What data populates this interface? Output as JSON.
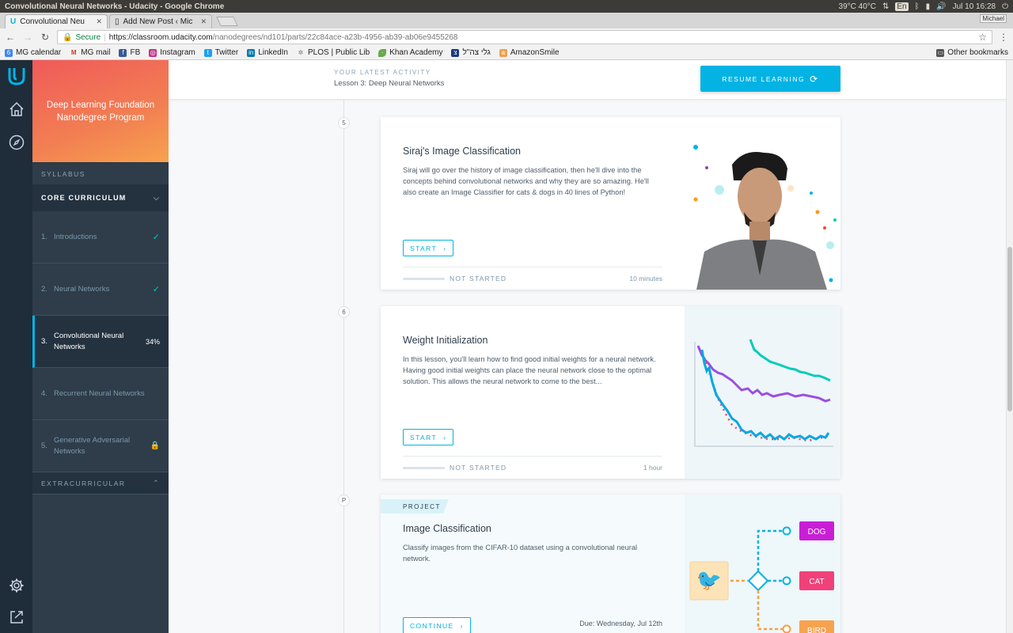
{
  "os": {
    "window_title": "Convolutional Neural Networks - Udacity - Google Chrome",
    "weather": "39°C 40°C",
    "lang": "En",
    "datetime": "Jul 10 16:28"
  },
  "tabs": [
    {
      "label": "Convolutional Neu",
      "active": true
    },
    {
      "label": "Add New Post ‹ Mic",
      "active": false
    }
  ],
  "profile": "Michael",
  "address": {
    "secure_label": "Secure",
    "url_host": "https://classroom.udacity.com",
    "url_path": "/nanodegrees/nd101/parts/22c84ace-a23b-4956-ab39-ab06e9455268"
  },
  "bookmarks": [
    {
      "label": "MG calendar",
      "icon": "calendar-icon",
      "color": "#4285f4"
    },
    {
      "label": "MG mail",
      "icon": "gmail-icon",
      "color": "#d93025"
    },
    {
      "label": "FB",
      "icon": "facebook-icon",
      "color": "#3b5998"
    },
    {
      "label": "Instagram",
      "icon": "instagram-icon",
      "color": "#c13584"
    },
    {
      "label": "Twitter",
      "icon": "twitter-icon",
      "color": "#1da1f2"
    },
    {
      "label": "LinkedIn",
      "icon": "linkedin-icon",
      "color": "#0077b5"
    },
    {
      "label": "PLOS | Public Lib",
      "icon": "plos-icon",
      "color": "#777777"
    },
    {
      "label": "Khan Academy",
      "icon": "khan-icon",
      "color": "#6aa84f"
    },
    {
      "label": "גלי צה\"ל",
      "icon": "galatz-icon",
      "color": "#1a3a7a"
    },
    {
      "label": "AmazonSmile",
      "icon": "amazon-icon",
      "color": "#f0a04b"
    }
  ],
  "other_bookmarks": "Other bookmarks",
  "sidebar": {
    "program": "Deep Learning Foundation Nanodegree Program",
    "syllabus_label": "SYLLABUS",
    "core_label": "CORE CURRICULUM",
    "items": [
      {
        "num": "1.",
        "label": "Introductions",
        "state": "done"
      },
      {
        "num": "2.",
        "label": "Neural Networks",
        "state": "done"
      },
      {
        "num": "3.",
        "label": "Convolutional Neural Networks",
        "state": "active",
        "pct": "34%"
      },
      {
        "num": "4.",
        "label": "Recurrent Neural Networks",
        "state": "open"
      },
      {
        "num": "5.",
        "label": "Generative Adversarial Networks",
        "state": "locked"
      }
    ],
    "extracurricular_label": "EXTRACURRICULAR"
  },
  "activity": {
    "label": "YOUR LATEST ACTIVITY",
    "lesson": "Lesson 3: Deep Neural Networks",
    "resume_label": "RESUME LEARNING"
  },
  "lessons": [
    {
      "node": "5",
      "title": "Siraj's Image Classification",
      "description": "Siraj will go over the history of image classification, then he'll dive into the concepts behind convolutional networks and why they are so amazing. He'll also create an Image Classifier for cats & dogs in 40 lines of Python!",
      "button": "START",
      "status": "NOT STARTED",
      "duration": "10 minutes",
      "progress": 0
    },
    {
      "node": "6",
      "title": "Weight Initialization",
      "description": "In this lesson, you'll learn how to find good initial weights for a neural network. Having good initial weights can place the neural network close to the optimal solution. This allows the neural network to come to the best...",
      "button": "START",
      "status": "NOT STARTED",
      "duration": "1 hour",
      "progress": 0
    },
    {
      "node": "P",
      "tag": "PROJECT",
      "title": "Image Classification",
      "description": "Classify images from the CIFAR-10 dataset using a convolutional neural network.",
      "button": "CONTINUE",
      "due": "Due: Wednesday, Jul 12th",
      "classes": [
        "DOG",
        "CAT",
        "BIRD"
      ]
    }
  ],
  "colors": {
    "accent": "#02b3e4",
    "teal": "#02ccba",
    "sidebar_bg": "#2e3d49",
    "dog": "#c81fd6",
    "cat": "#f0417a",
    "bird": "#f7a24e"
  }
}
